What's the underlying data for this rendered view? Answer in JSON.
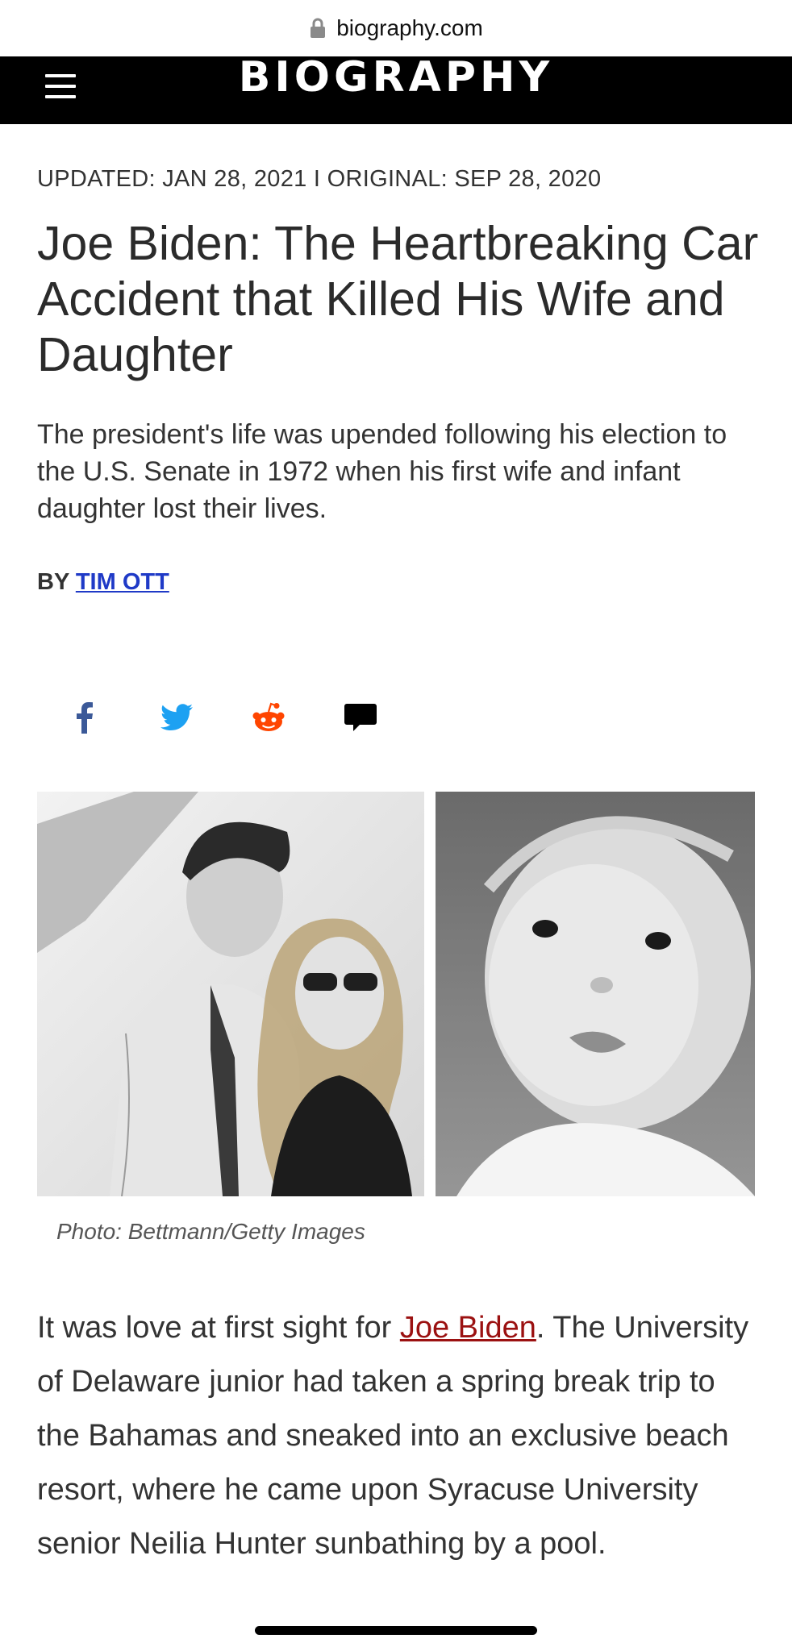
{
  "browser": {
    "url": "biography.com"
  },
  "header": {
    "logo": "BIOGRAPHY",
    "brand_color": "#000000",
    "accent_color": "#d0021b"
  },
  "article": {
    "meta": "UPDATED: JAN 28, 2021 I ORIGINAL: SEP 28, 2020",
    "title": "Joe Biden: The Heartbreaking Car Accident that Killed His Wife and Daughter",
    "dek": "The president's life was upended following his election to the U.S. Senate in 1972 when his first wife and infant daughter lost their lives.",
    "byline_prefix": "BY ",
    "author": "TIM OTT",
    "share_icons": [
      "facebook-icon",
      "twitter-icon",
      "reddit-icon",
      "comment-icon"
    ],
    "photo_caption": "Photo: Bettmann/Getty Images",
    "body_before_link": "It was love at first sight for ",
    "body_link": "Joe Biden",
    "body_after_link": ". The University of Delaware junior had taken a spring break trip to the Bahamas and sneaked into an exclusive beach resort, where he came upon Syracuse University senior Neilia Hunter sunbathing by a pool."
  }
}
